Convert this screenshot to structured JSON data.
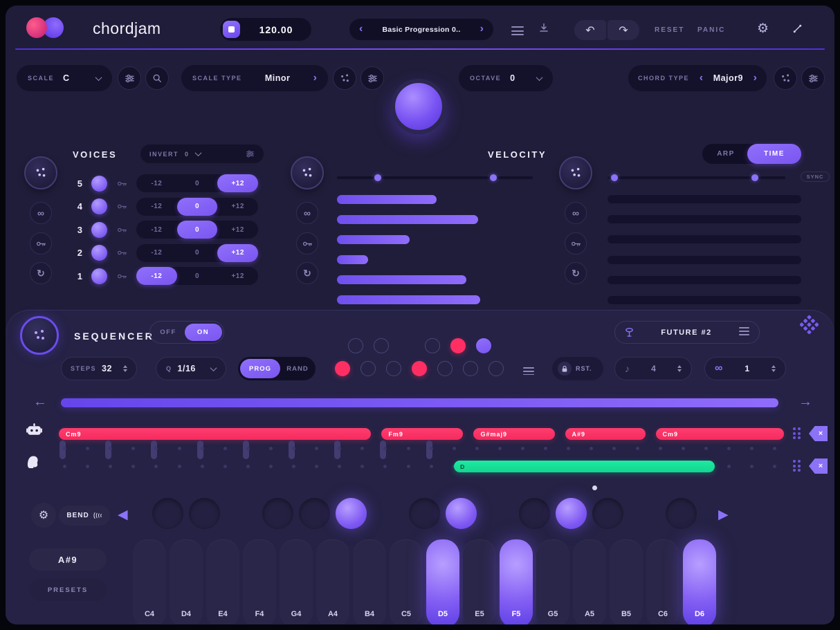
{
  "header": {
    "app_name": "chordjam",
    "bpm_value": "120.00",
    "preset_value": "Basic Progression 0..",
    "reset_label": "RESET",
    "panic_label": "PANIC"
  },
  "controls_row": {
    "scale_label": "SCALE",
    "scale_value": "C",
    "scale_type_label": "SCALE TYPE",
    "scale_type_value": "Minor",
    "octave_label": "OCTAVE",
    "octave_value": "0",
    "chord_type_label": "CHORD TYPE",
    "chord_type_value": "Major9"
  },
  "voices": {
    "title": "VOICES",
    "invert_label": "INVERT",
    "invert_value": "0",
    "options": [
      "-12",
      "0",
      "+12"
    ],
    "rows": [
      {
        "num": "5",
        "on": true,
        "active": "+12"
      },
      {
        "num": "4",
        "on": true,
        "active": "0"
      },
      {
        "num": "3",
        "on": true,
        "active": "0"
      },
      {
        "num": "2",
        "on": true,
        "active": "+12"
      },
      {
        "num": "1",
        "on": true,
        "active": "-12"
      }
    ]
  },
  "velocity": {
    "title": "VELOCITY",
    "slider_dots_pct": [
      19,
      78
    ],
    "bars_pct": [
      51,
      72,
      37,
      16,
      66,
      73
    ]
  },
  "time": {
    "arp_label": "ARP",
    "time_label": "TIME",
    "active_tab": "TIME",
    "sync_label": "SYNC",
    "slider_dots_pct": [
      2,
      81
    ],
    "bars_pct": [
      0,
      0,
      0,
      0,
      0,
      0
    ]
  },
  "sequencer": {
    "title": "SEQUENCER",
    "off_label": "OFF",
    "on_label": "ON",
    "power": "ON",
    "steps_label": "STEPS",
    "steps_value": "32",
    "quantize_label": "Q",
    "quantize_value": "1/16",
    "prog_label": "PROG",
    "rand_label": "RAND",
    "mode": "PROG",
    "preset_name": "FUTURE #2",
    "reset_label": "RST.",
    "bars_value": "4",
    "loop_value": "1",
    "total_steps": 32,
    "step_dots_top": [
      "outline",
      "outline",
      "spacer",
      "outline",
      "pink",
      "purple"
    ],
    "step_dots_bottom": [
      "pink",
      "outline",
      "outline",
      "pink",
      "outline",
      "outline",
      "outline"
    ],
    "chord_lane": {
      "chords": [
        {
          "label": "Cm9",
          "start_pct": 0,
          "width_pct": 43.0
        },
        {
          "label": "Fm9",
          "start_pct": 44.5,
          "width_pct": 11.2
        },
        {
          "label": "G#maj9",
          "start_pct": 57.2,
          "width_pct": 11.2
        },
        {
          "label": "A#9",
          "start_pct": 69.8,
          "width_pct": 11.1
        },
        {
          "label": "Cm9",
          "start_pct": 82.3,
          "width_pct": 17.7
        }
      ],
      "stem_steps": [
        0,
        2,
        4,
        6,
        8,
        10,
        12,
        14,
        16
      ]
    },
    "note_lane": {
      "notes": [
        {
          "label": "D",
          "start_pct": 54.5,
          "width_pct": 36.0
        }
      ]
    }
  },
  "keyboard": {
    "bend_label": "BEND",
    "chord_label": "A#9",
    "presets_label": "PRESETS",
    "white_keys": [
      {
        "label": "C4",
        "active": false
      },
      {
        "label": "D4",
        "active": false
      },
      {
        "label": "E4",
        "active": false
      },
      {
        "label": "F4",
        "active": false
      },
      {
        "label": "G4",
        "active": false
      },
      {
        "label": "A4",
        "active": false
      },
      {
        "label": "B4",
        "active": false
      },
      {
        "label": "C5",
        "active": false
      },
      {
        "label": "D5",
        "active": true
      },
      {
        "label": "E5",
        "active": false
      },
      {
        "label": "F5",
        "active": true
      },
      {
        "label": "G5",
        "active": false
      },
      {
        "label": "A5",
        "active": false
      },
      {
        "label": "B5",
        "active": false
      },
      {
        "label": "C6",
        "active": false
      },
      {
        "label": "D6",
        "active": true
      }
    ],
    "black_keys": [
      {
        "note": "C#4",
        "gap": 1,
        "active": false
      },
      {
        "note": "D#4",
        "gap": 2,
        "active": false
      },
      {
        "note": "F#4",
        "gap": 4,
        "active": false
      },
      {
        "note": "G#4",
        "gap": 5,
        "active": false
      },
      {
        "note": "A#4",
        "gap": 6,
        "active": true
      },
      {
        "note": "C#5",
        "gap": 8,
        "active": false
      },
      {
        "note": "D#5",
        "gap": 9,
        "active": true
      },
      {
        "note": "F#5",
        "gap": 11,
        "active": false
      },
      {
        "note": "G#5",
        "gap": 12,
        "active": true
      },
      {
        "note": "A#5",
        "gap": 13,
        "active": false
      },
      {
        "note": "C#6",
        "gap": 15,
        "active": false
      }
    ]
  },
  "icons": {
    "gear": "⚙",
    "undo": "↶",
    "redo": "↷",
    "refresh": "↻",
    "infinity": "∞",
    "note": "♪",
    "arrow_left": "←",
    "arrow_right": "→",
    "prev": "◀",
    "next": "▶",
    "chevron_left": "‹",
    "chevron_right": "›"
  },
  "colors": {
    "accent": "#7c5af5",
    "pink": "#ff2e63",
    "green": "#17e39c"
  }
}
